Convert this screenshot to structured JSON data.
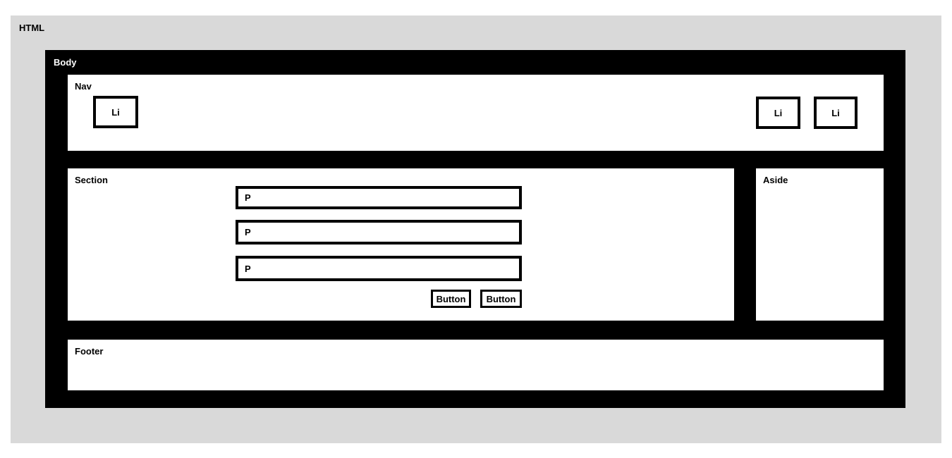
{
  "diagram": {
    "html_label": "HTML",
    "body_label": "Body",
    "nav": {
      "label": "Nav",
      "items": [
        {
          "label": "Li"
        },
        {
          "label": "Li"
        },
        {
          "label": "Li"
        }
      ]
    },
    "section": {
      "label": "Section",
      "paragraphs": [
        {
          "label": "P"
        },
        {
          "label": "P"
        },
        {
          "label": "P"
        }
      ],
      "buttons": [
        {
          "label": "Button"
        },
        {
          "label": "Button"
        }
      ]
    },
    "aside": {
      "label": "Aside"
    },
    "footer": {
      "label": "Footer"
    }
  },
  "colors": {
    "html_background": "#d9d9d9",
    "body_background": "#000000",
    "panel_background": "#ffffff",
    "border": "#000000"
  }
}
